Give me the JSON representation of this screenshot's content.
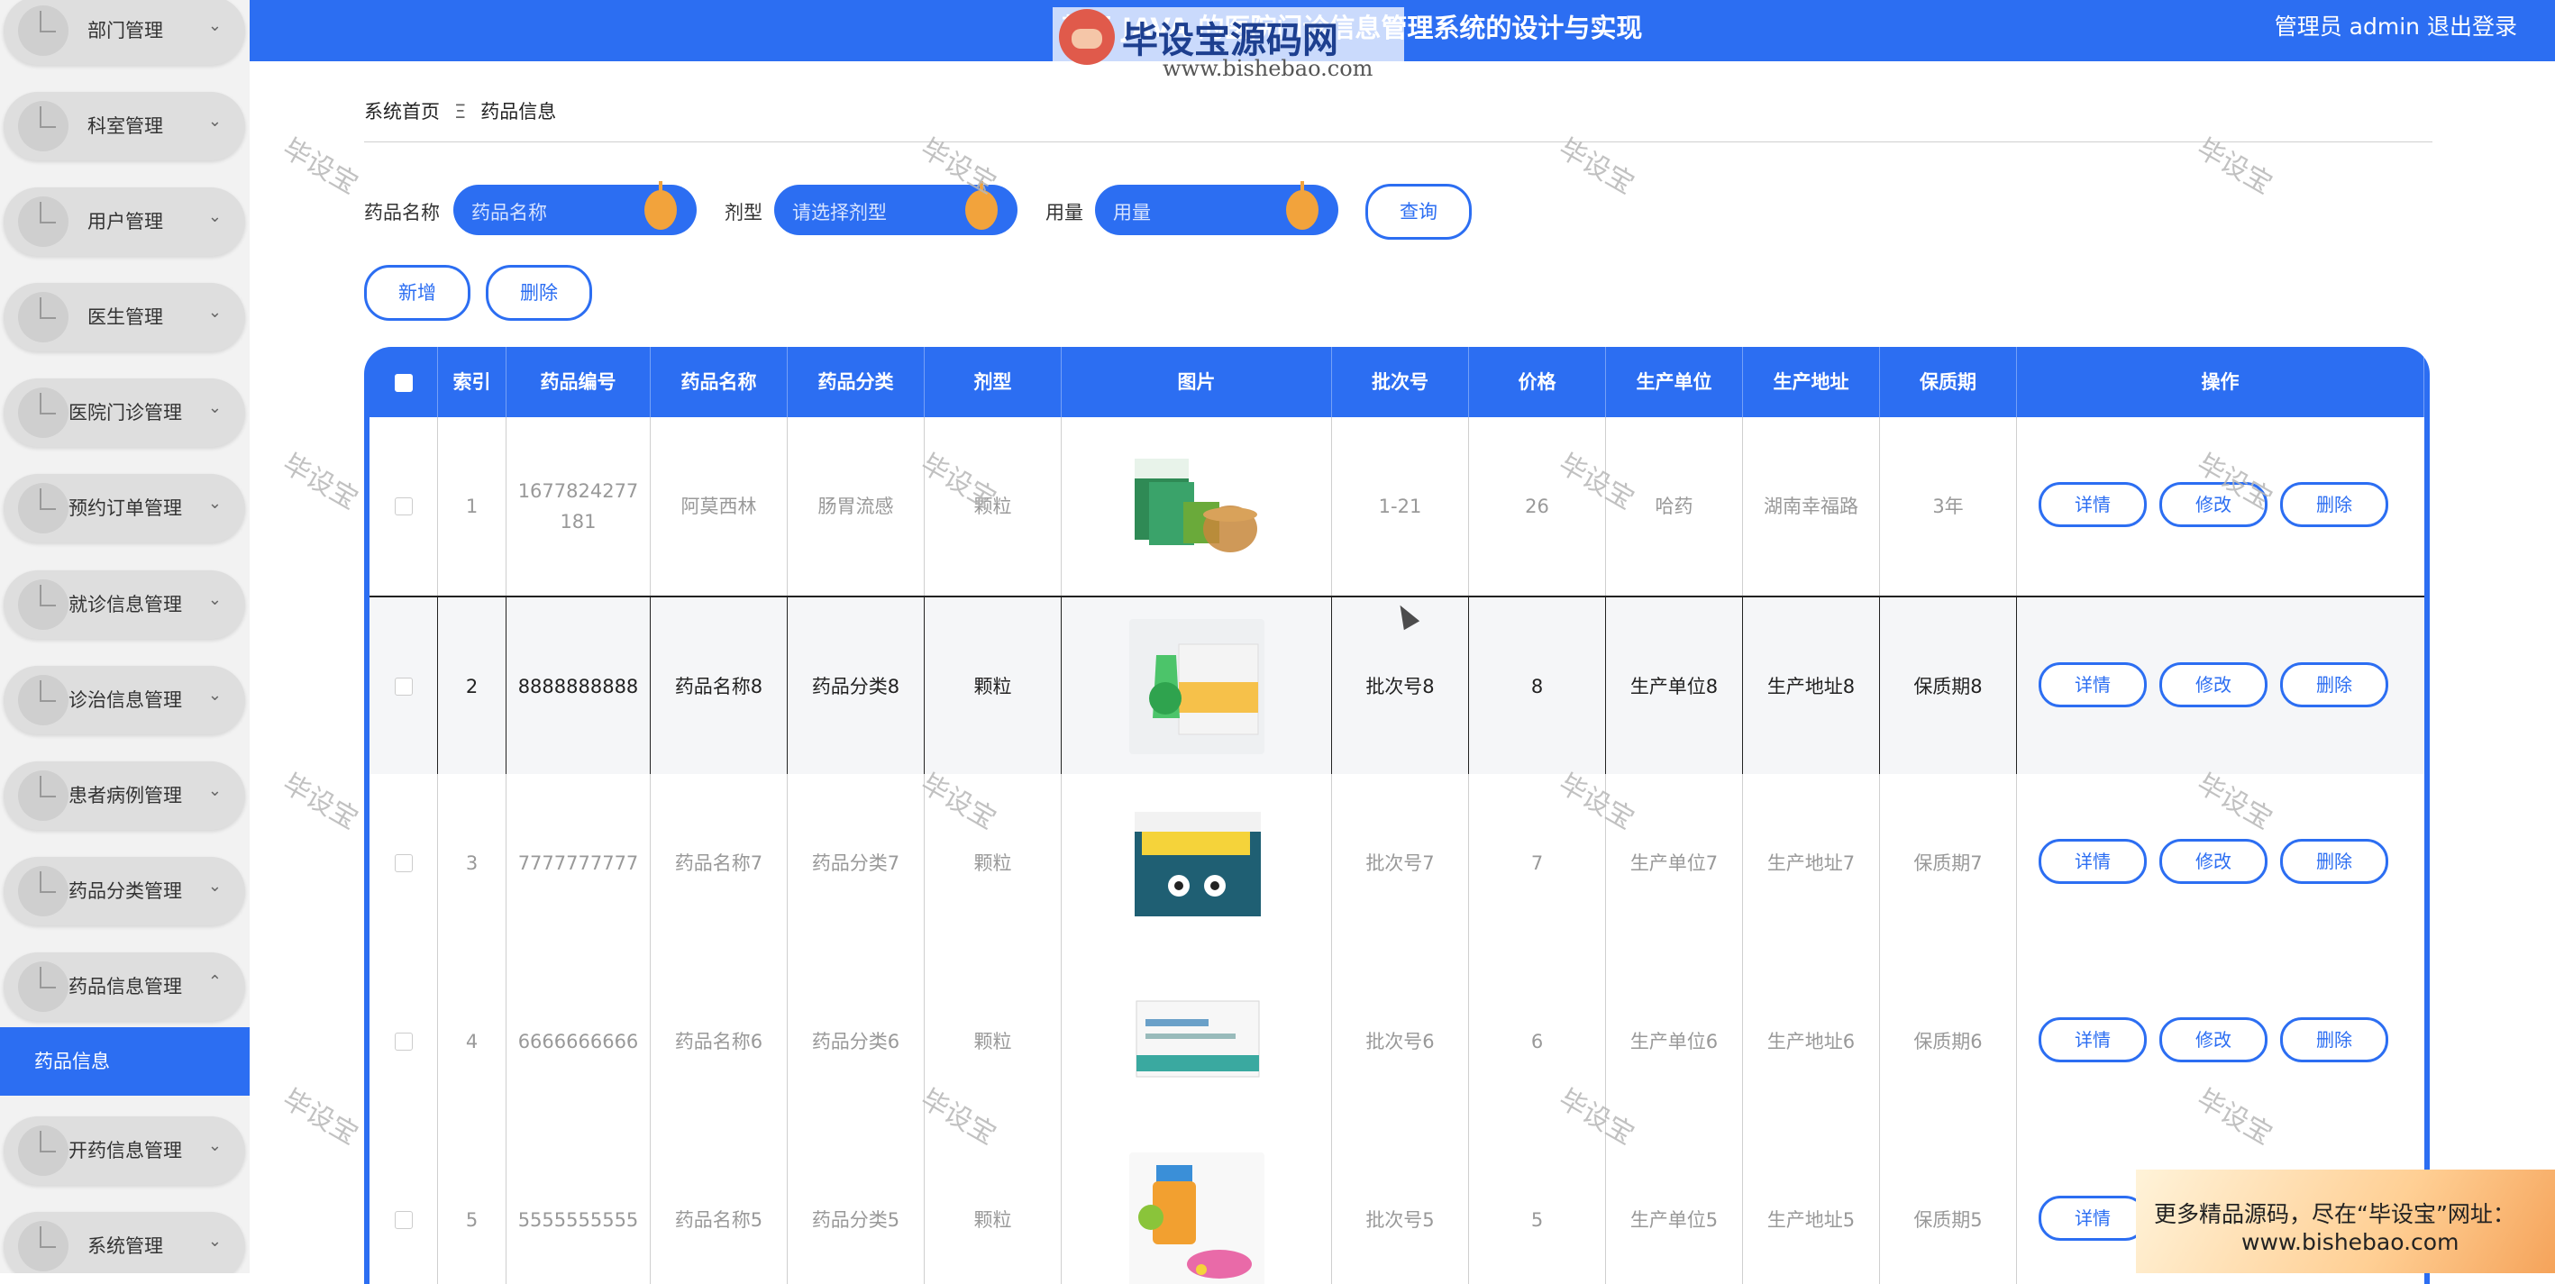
{
  "sidebar": {
    "items": [
      {
        "label": "部门管理",
        "expanded": false
      },
      {
        "label": "科室管理",
        "expanded": false
      },
      {
        "label": "用户管理",
        "expanded": false
      },
      {
        "label": "医生管理",
        "expanded": false
      },
      {
        "label": "医院门诊管理",
        "expanded": false
      },
      {
        "label": "预约订单管理",
        "expanded": false
      },
      {
        "label": "就诊信息管理",
        "expanded": false
      },
      {
        "label": "诊治信息管理",
        "expanded": false
      },
      {
        "label": "患者病例管理",
        "expanded": false
      },
      {
        "label": "药品分类管理",
        "expanded": false
      },
      {
        "label": "药品信息管理",
        "expanded": true
      },
      {
        "label": "开药信息管理",
        "expanded": false
      },
      {
        "label": "系统管理",
        "expanded": false
      }
    ],
    "active_sub": "药品信息",
    "chevron_down": "⌄",
    "chevron_up": "⌃",
    "accent": "#2c6ef2"
  },
  "header": {
    "title": "基于 JAVA 的医院门诊信息管理系统的设计与实现",
    "user": "管理员 admin",
    "logout": "退出登录",
    "bg": "#2c6ef2"
  },
  "logo": {
    "text": "毕设宝源码网",
    "url": "www.bishebao.com"
  },
  "breadcrumb": {
    "home": "系统首页",
    "sep": "Ξ",
    "current": "药品信息"
  },
  "search": {
    "name_label": "药品名称",
    "name_placeholder": "药品名称",
    "form_label": "剂型",
    "form_placeholder": "请选择剂型",
    "dose_label": "用量",
    "dose_placeholder": "用量",
    "query_button": "查询"
  },
  "actions": {
    "add": "新增",
    "delete": "删除"
  },
  "table": {
    "columns": [
      "索引",
      "药品编号",
      "药品名称",
      "药品分类",
      "剂型",
      "图片",
      "批次号",
      "价格",
      "生产单位",
      "生产地址",
      "保质期",
      "操作"
    ],
    "row_actions": {
      "detail": "详情",
      "edit": "修改",
      "delete": "删除"
    },
    "rows": [
      {
        "index": "1",
        "code": "1677824277\n181",
        "name": "阿莫西林",
        "category": "肠胃流感",
        "form": "颗粒",
        "image": "green-medicine-box",
        "batch": "1-21",
        "price": "26",
        "maker": "哈药",
        "address": "湖南幸福路",
        "shelf": "3年",
        "active": false
      },
      {
        "index": "2",
        "code": "8888888888",
        "name": "药品名称8",
        "category": "药品分类8",
        "form": "颗粒",
        "image": "green-pill-pack",
        "batch": "批次号8",
        "price": "8",
        "maker": "生产单位8",
        "address": "生产地址8",
        "shelf": "保质期8",
        "active": true
      },
      {
        "index": "3",
        "code": "7777777777",
        "name": "药品名称7",
        "category": "药品分类7",
        "form": "颗粒",
        "image": "cough-capsule-box",
        "batch": "批次号7",
        "price": "7",
        "maker": "生产单位7",
        "address": "生产地址7",
        "shelf": "保质期7",
        "active": false
      },
      {
        "index": "4",
        "code": "6666666666",
        "name": "药品名称6",
        "category": "药品分类6",
        "form": "颗粒",
        "image": "white-medicine-box",
        "batch": "批次号6",
        "price": "6",
        "maker": "生产单位6",
        "address": "生产地址6",
        "shelf": "保质期6",
        "active": false
      },
      {
        "index": "5",
        "code": "5555555555",
        "name": "药品名称5",
        "category": "药品分类5",
        "form": "颗粒",
        "image": "pill-bottles",
        "batch": "批次号5",
        "price": "5",
        "maker": "生产单位5",
        "address": "生产地址5",
        "shelf": "保质期5",
        "active": false
      }
    ]
  },
  "watermark": "毕设宝",
  "promo": {
    "line1": "更多精品源码，尽在“毕设宝”网址：",
    "line2": "www.bishebao.com"
  }
}
